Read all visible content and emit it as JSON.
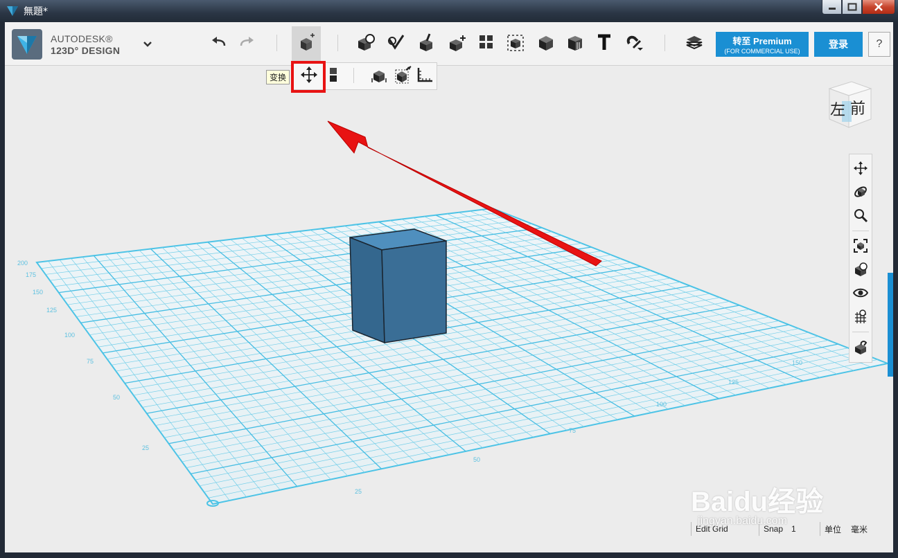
{
  "window": {
    "title": "無題*",
    "min_label": "—",
    "max_label": "□",
    "close_label": "✕"
  },
  "brand": {
    "line1": "AUTODESK®",
    "line2": "123D° DESIGN"
  },
  "toolbar": {
    "icons": [
      "undo-icon",
      "redo-icon",
      "transform-icon",
      "primitives-icon",
      "sketch-icon",
      "construct-icon",
      "modify-icon",
      "pattern-icon",
      "grouping-icon",
      "combine-icon",
      "measure-icon",
      "text-icon",
      "snap-icon",
      "material-icon"
    ],
    "premium_line1": "转至 Premium",
    "premium_line2": "(FOR COMMERCIAL USE)",
    "login_label": "登录",
    "help_label": "?"
  },
  "subtoolbar": {
    "tooltip": "变换",
    "items": [
      "move-icon",
      "align-icon",
      "tweak-icon",
      "smart-scale-icon",
      "ruler-icon"
    ]
  },
  "viewcube": {
    "left_label": "左",
    "front_label": "前"
  },
  "navbar": {
    "items": [
      "pan-icon",
      "orbit-icon",
      "zoom-icon",
      "fit-icon",
      "view-mode-icon",
      "visibility-icon",
      "grid-icon",
      "material-preview-icon"
    ]
  },
  "grid": {
    "labels_left": [
      "200",
      "175",
      "150",
      "125",
      "100",
      "75",
      "50",
      "25"
    ],
    "labels_front": [
      "25",
      "50",
      "75",
      "100",
      "125",
      "150"
    ]
  },
  "status": {
    "edit_grid": "Edit Grid",
    "snap_label": "Snap",
    "snap_value": "1",
    "unit_label": "单位",
    "unit_value": "毫米"
  },
  "watermark": {
    "brand": "Baidu经验",
    "url": "jingyan.baidu.com"
  },
  "colors": {
    "accent": "#1a8fd3",
    "cube": "#3b6f98",
    "grid": "#4cc3e6",
    "highlight": "#e81313"
  }
}
